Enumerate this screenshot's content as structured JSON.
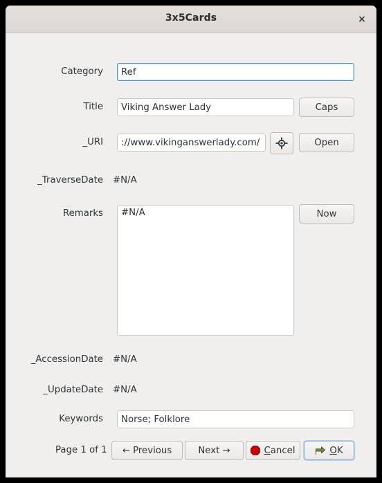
{
  "window": {
    "title": "3x5Cards",
    "close_label": "×",
    "close_icon": "close-icon"
  },
  "form": {
    "fields": [
      {
        "key": "category",
        "label": "Category",
        "type": "text",
        "value": "Ref",
        "focused": true
      },
      {
        "key": "title",
        "label": "Title",
        "type": "text",
        "value": "Viking Answer Lady",
        "focused": false
      },
      {
        "key": "uri",
        "label": "_URI",
        "type": "text",
        "value": "://www.vikinganswerlady.com/",
        "focused": false
      },
      {
        "key": "traverse_date",
        "label": "_TraverseDate",
        "type": "static",
        "value": "#N/A"
      },
      {
        "key": "remarks",
        "label": "Remarks",
        "type": "textarea",
        "value": "#N/A"
      },
      {
        "key": "accession_date",
        "label": "_AccessionDate",
        "type": "static",
        "value": "#N/A"
      },
      {
        "key": "update_date",
        "label": "_UpdateDate",
        "type": "static",
        "value": "#N/A"
      },
      {
        "key": "keywords",
        "label": "Keywords",
        "type": "text",
        "value": "Norse; Folklore",
        "focused": false
      }
    ],
    "side_buttons": {
      "caps": "Caps",
      "open": "Open",
      "now": "Now",
      "uri_target_icon": "crosshair-target-icon"
    }
  },
  "footer": {
    "page_status": "Page 1 of 1",
    "previous_label": "← Previous",
    "next_label": "Next →",
    "cancel_prefix": "",
    "cancel_mnemonic": "C",
    "cancel_rest": "ancel",
    "cancel_icon": "stop-icon",
    "ok_mnemonic": "O",
    "ok_rest": "K",
    "ok_icon": "enter-arrow-icon"
  },
  "colors": {
    "titlebar": "#dcd9d4",
    "body": "#f0efee",
    "focus_border": "#4a90d9",
    "cancel_red": "#cc0000",
    "ok_green": "#6f7e3f",
    "text": "#2e3436"
  }
}
